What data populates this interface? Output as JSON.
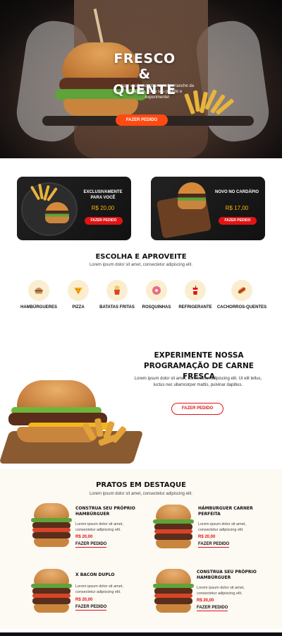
{
  "hero": {
    "title_line1": "FRESCO &",
    "title_line2": "QUENTE",
    "subtitle": "Aqui você encontra o melhor lanche da cidade. Faça seu pedido e experimente!",
    "button": "FAZER PEDIDO"
  },
  "promos": [
    {
      "title": "EXCLUSIVAMENTE PARA VOCÊ",
      "price": "R$ 20,00",
      "button": "FAZER PEDIDO"
    },
    {
      "title": "NOVO NO CARDÁPIO",
      "price": "R$ 17,00",
      "button": "FAZER PEDIDO"
    }
  ],
  "categories_section": {
    "title": "ESCOLHA E APROVEITE",
    "subtitle": "Lorem ipsum dolor sit amet, consectetur adipiscing elit.",
    "items": [
      {
        "label": "HAMBÚRGUERES",
        "icon": "burger-icon"
      },
      {
        "label": "PIZZA",
        "icon": "pizza-icon"
      },
      {
        "label": "BATATAS FRITAS",
        "icon": "fries-icon"
      },
      {
        "label": "ROSQUINHAS",
        "icon": "donut-icon"
      },
      {
        "label": "REFRIGERANTE",
        "icon": "soda-icon"
      },
      {
        "label": "CACHORROS-QUENTES",
        "icon": "hotdog-icon"
      }
    ]
  },
  "feature": {
    "title_line1": "EXPERIMENTE NOSSA",
    "title_line2": "PROGRAMAÇÃO DE CARNE FRESCA",
    "text": "Lorem ipsum dolor sit amet, consectetur adipiscing elit. Ut elit tellus, luctus nec ullamcorper mattis, pulvinar dapibus.",
    "button": "FAZER PEDIDO"
  },
  "dishes_section": {
    "title": "PRATOS EM DESTAQUE",
    "subtitle": "Lorem ipsum dolor sit amet, consectetur adipiscing elit.",
    "items": [
      {
        "title": "CONSTRUA SEU PRÓPRIO HAMBÚRGUER",
        "desc": "Lorem ipsum dolor sit amet, consectetur adipiscing elit.",
        "price": "R$ 20,00",
        "link": "FAZER PEDIDO"
      },
      {
        "title": "HÁMBURGUER CARNER PERFEITA",
        "desc": "Lorem ipsum dolor sit amet, consectetur adipiscing elit.",
        "price": "R$ 20,00",
        "link": "FAZER PEDIDO"
      },
      {
        "title": "X BACON DUPLO",
        "desc": "Lorem ipsum dolor sit amet, consectetur adipiscing elit.",
        "price": "R$ 20,00",
        "link": "FAZER PEDIDO"
      },
      {
        "title": "CONSTRUA SEU PRÓPRIO HAMBÚRGUER",
        "desc": "Lorem ipsum dolor sit amet, consectetur adipiscing elit.",
        "price": "R$ 20,00",
        "link": "FAZER PEDIDO"
      }
    ]
  },
  "colors": {
    "accent": "#ff4a14",
    "promo_button": "#e01414",
    "price": "#ffb400",
    "category_bg": "#fbeed0"
  }
}
